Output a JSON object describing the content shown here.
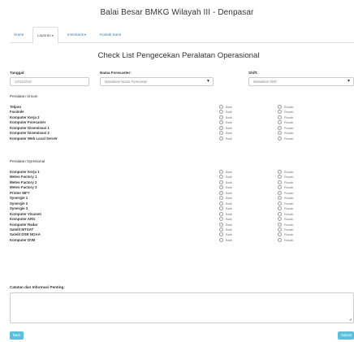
{
  "site": {
    "title": "Balai Besar BMKG Wilayah III - Denpasar"
  },
  "nav": {
    "items": [
      {
        "label": "Home"
      },
      {
        "label": "Laporan"
      },
      {
        "label": "Inventaris"
      },
      {
        "label": "Kontak Kami"
      }
    ],
    "caret": "▾"
  },
  "form": {
    "title": "Check List Pengecekan Peralatan Operasional",
    "date": {
      "label": "Tanggal:",
      "value": "13/11/2018"
    },
    "forecaster": {
      "label": "Nama Forecaster:",
      "placeholder": "Masukkan Nama Forecaster"
    },
    "shift": {
      "label": "Shift:",
      "placeholder": "Masukkan Shift"
    },
    "select_arrow": "▼",
    "option_good": "Baik",
    "option_bad": "Rusak"
  },
  "sections": [
    {
      "title": "Peralatan Umum",
      "items": [
        "Telpon",
        "Faximile",
        "Komputer Kerja 2",
        "Komputer Forecaster",
        "Komputer Diseminasi 1",
        "Komputer Diseminasi 2",
        "Komputer Web Local Server"
      ]
    },
    {
      "title": "Peralatan Opresional",
      "items": [
        "Komputer Kerja 1",
        "Meteo Factory 1",
        "Meteo Factory 2",
        "Meteo Factory 3",
        "Printer MFY",
        "Synergie 1",
        "Synergie 2",
        "Synergie 3",
        "Komputer Visumet",
        "Komputer ARG",
        "Komputer Radar",
        "Satelit MTSAT",
        "Satelit DSR NOAA",
        "Komputer DVB"
      ]
    }
  ],
  "notes": {
    "label": "Catatan dan Informasi Penting:"
  },
  "buttons": {
    "back": "Back",
    "submit": "Submit"
  }
}
